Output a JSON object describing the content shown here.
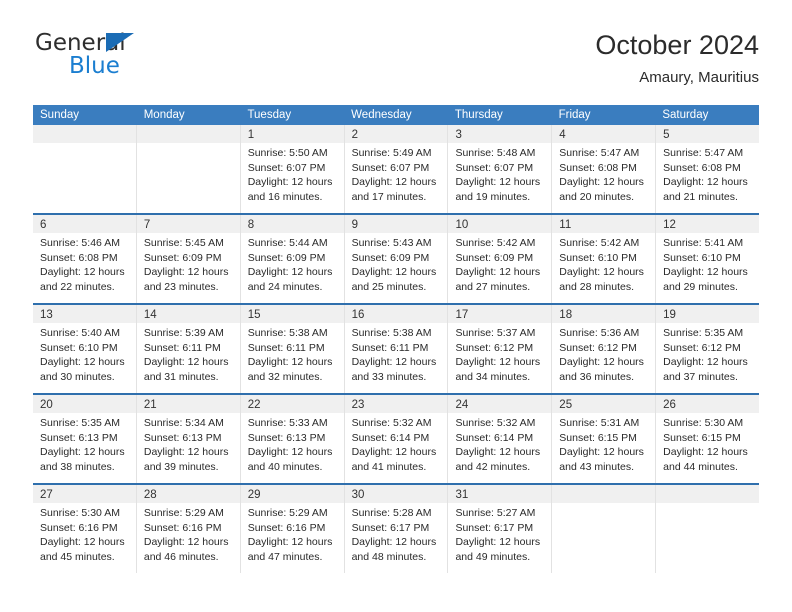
{
  "brand": {
    "name_top": "General",
    "name_bottom": "Blue",
    "triangle_color": "#1b6cb5",
    "blue_text_color": "#1b7ed0"
  },
  "header": {
    "title": "October 2024",
    "subtitle": "Amaury, Mauritius"
  },
  "theme": {
    "header_row_bg": "#3a7dbf",
    "week_divider": "#2f6fad",
    "daynum_band_bg": "#f0f0f0",
    "cell_border": "#e2e2e2",
    "text": "#2a2a2a"
  },
  "calendar": {
    "weekday_headers": [
      "Sunday",
      "Monday",
      "Tuesday",
      "Wednesday",
      "Thursday",
      "Friday",
      "Saturday"
    ],
    "weeks": [
      [
        {
          "day": "",
          "lines": []
        },
        {
          "day": "",
          "lines": []
        },
        {
          "day": "1",
          "lines": [
            "Sunrise: 5:50 AM",
            "Sunset: 6:07 PM",
            "Daylight: 12 hours",
            "and 16 minutes."
          ]
        },
        {
          "day": "2",
          "lines": [
            "Sunrise: 5:49 AM",
            "Sunset: 6:07 PM",
            "Daylight: 12 hours",
            "and 17 minutes."
          ]
        },
        {
          "day": "3",
          "lines": [
            "Sunrise: 5:48 AM",
            "Sunset: 6:07 PM",
            "Daylight: 12 hours",
            "and 19 minutes."
          ]
        },
        {
          "day": "4",
          "lines": [
            "Sunrise: 5:47 AM",
            "Sunset: 6:08 PM",
            "Daylight: 12 hours",
            "and 20 minutes."
          ]
        },
        {
          "day": "5",
          "lines": [
            "Sunrise: 5:47 AM",
            "Sunset: 6:08 PM",
            "Daylight: 12 hours",
            "and 21 minutes."
          ]
        }
      ],
      [
        {
          "day": "6",
          "lines": [
            "Sunrise: 5:46 AM",
            "Sunset: 6:08 PM",
            "Daylight: 12 hours",
            "and 22 minutes."
          ]
        },
        {
          "day": "7",
          "lines": [
            "Sunrise: 5:45 AM",
            "Sunset: 6:09 PM",
            "Daylight: 12 hours",
            "and 23 minutes."
          ]
        },
        {
          "day": "8",
          "lines": [
            "Sunrise: 5:44 AM",
            "Sunset: 6:09 PM",
            "Daylight: 12 hours",
            "and 24 minutes."
          ]
        },
        {
          "day": "9",
          "lines": [
            "Sunrise: 5:43 AM",
            "Sunset: 6:09 PM",
            "Daylight: 12 hours",
            "and 25 minutes."
          ]
        },
        {
          "day": "10",
          "lines": [
            "Sunrise: 5:42 AM",
            "Sunset: 6:09 PM",
            "Daylight: 12 hours",
            "and 27 minutes."
          ]
        },
        {
          "day": "11",
          "lines": [
            "Sunrise: 5:42 AM",
            "Sunset: 6:10 PM",
            "Daylight: 12 hours",
            "and 28 minutes."
          ]
        },
        {
          "day": "12",
          "lines": [
            "Sunrise: 5:41 AM",
            "Sunset: 6:10 PM",
            "Daylight: 12 hours",
            "and 29 minutes."
          ]
        }
      ],
      [
        {
          "day": "13",
          "lines": [
            "Sunrise: 5:40 AM",
            "Sunset: 6:10 PM",
            "Daylight: 12 hours",
            "and 30 minutes."
          ]
        },
        {
          "day": "14",
          "lines": [
            "Sunrise: 5:39 AM",
            "Sunset: 6:11 PM",
            "Daylight: 12 hours",
            "and 31 minutes."
          ]
        },
        {
          "day": "15",
          "lines": [
            "Sunrise: 5:38 AM",
            "Sunset: 6:11 PM",
            "Daylight: 12 hours",
            "and 32 minutes."
          ]
        },
        {
          "day": "16",
          "lines": [
            "Sunrise: 5:38 AM",
            "Sunset: 6:11 PM",
            "Daylight: 12 hours",
            "and 33 minutes."
          ]
        },
        {
          "day": "17",
          "lines": [
            "Sunrise: 5:37 AM",
            "Sunset: 6:12 PM",
            "Daylight: 12 hours",
            "and 34 minutes."
          ]
        },
        {
          "day": "18",
          "lines": [
            "Sunrise: 5:36 AM",
            "Sunset: 6:12 PM",
            "Daylight: 12 hours",
            "and 36 minutes."
          ]
        },
        {
          "day": "19",
          "lines": [
            "Sunrise: 5:35 AM",
            "Sunset: 6:12 PM",
            "Daylight: 12 hours",
            "and 37 minutes."
          ]
        }
      ],
      [
        {
          "day": "20",
          "lines": [
            "Sunrise: 5:35 AM",
            "Sunset: 6:13 PM",
            "Daylight: 12 hours",
            "and 38 minutes."
          ]
        },
        {
          "day": "21",
          "lines": [
            "Sunrise: 5:34 AM",
            "Sunset: 6:13 PM",
            "Daylight: 12 hours",
            "and 39 minutes."
          ]
        },
        {
          "day": "22",
          "lines": [
            "Sunrise: 5:33 AM",
            "Sunset: 6:13 PM",
            "Daylight: 12 hours",
            "and 40 minutes."
          ]
        },
        {
          "day": "23",
          "lines": [
            "Sunrise: 5:32 AM",
            "Sunset: 6:14 PM",
            "Daylight: 12 hours",
            "and 41 minutes."
          ]
        },
        {
          "day": "24",
          "lines": [
            "Sunrise: 5:32 AM",
            "Sunset: 6:14 PM",
            "Daylight: 12 hours",
            "and 42 minutes."
          ]
        },
        {
          "day": "25",
          "lines": [
            "Sunrise: 5:31 AM",
            "Sunset: 6:15 PM",
            "Daylight: 12 hours",
            "and 43 minutes."
          ]
        },
        {
          "day": "26",
          "lines": [
            "Sunrise: 5:30 AM",
            "Sunset: 6:15 PM",
            "Daylight: 12 hours",
            "and 44 minutes."
          ]
        }
      ],
      [
        {
          "day": "27",
          "lines": [
            "Sunrise: 5:30 AM",
            "Sunset: 6:16 PM",
            "Daylight: 12 hours",
            "and 45 minutes."
          ]
        },
        {
          "day": "28",
          "lines": [
            "Sunrise: 5:29 AM",
            "Sunset: 6:16 PM",
            "Daylight: 12 hours",
            "and 46 minutes."
          ]
        },
        {
          "day": "29",
          "lines": [
            "Sunrise: 5:29 AM",
            "Sunset: 6:16 PM",
            "Daylight: 12 hours",
            "and 47 minutes."
          ]
        },
        {
          "day": "30",
          "lines": [
            "Sunrise: 5:28 AM",
            "Sunset: 6:17 PM",
            "Daylight: 12 hours",
            "and 48 minutes."
          ]
        },
        {
          "day": "31",
          "lines": [
            "Sunrise: 5:27 AM",
            "Sunset: 6:17 PM",
            "Daylight: 12 hours",
            "and 49 minutes."
          ]
        },
        {
          "day": "",
          "lines": []
        },
        {
          "day": "",
          "lines": []
        }
      ]
    ]
  }
}
